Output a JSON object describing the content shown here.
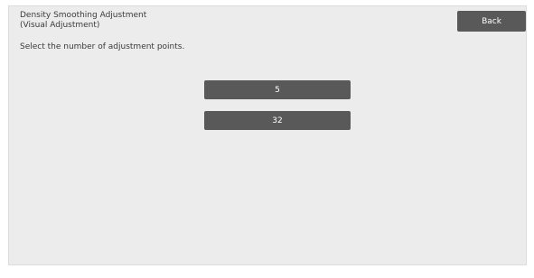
{
  "header": {
    "title_line1": "Density Smoothing Adjustment",
    "title_line2": "(Visual Adjustment)",
    "back_label": "Back"
  },
  "main": {
    "instruction": "Select the number of adjustment points.",
    "options": [
      {
        "label": "5"
      },
      {
        "label": "32"
      }
    ]
  }
}
